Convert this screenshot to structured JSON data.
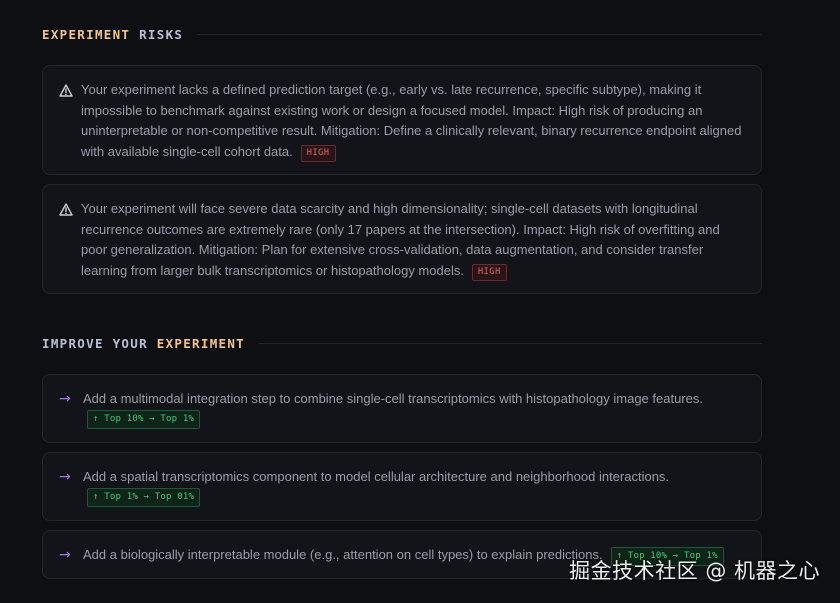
{
  "risks_section": {
    "title_accent": "EXPERIMENT",
    "title_plain": "RISKS",
    "items": [
      {
        "text": "Your experiment lacks a defined prediction target (e.g., early vs. late recurrence, specific subtype), making it impossible to benchmark against existing work or design a focused model. Impact: High risk of producing an uninterpretable or non-competitive result. Mitigation: Define a clinically relevant, binary recurrence endpoint aligned with available single-cell cohort data.",
        "severity": "HIGH",
        "icon": "warning-icon"
      },
      {
        "text": "Your experiment will face severe data scarcity and high dimensionality; single-cell datasets with longitudinal recurrence outcomes are extremely rare (only 17 papers at the intersection). Impact: High risk of overfitting and poor generalization. Mitigation: Plan for extensive cross-validation, data augmentation, and consider transfer learning from larger bulk transcriptomics or histopathology models.",
        "severity": "HIGH",
        "icon": "warning-icon"
      }
    ]
  },
  "improve_section": {
    "title_plain_1": "IMPROVE",
    "title_plain_2": "YOUR",
    "title_accent": "EXPERIMENT",
    "items": [
      {
        "text": "Add a multimodal integration step to combine single-cell transcriptomics with histopathology image features.",
        "badge": "↑ Top 10% → Top 1%",
        "icon": "arrow-right-icon"
      },
      {
        "text": "Add a spatial transcriptomics component to model cellular architecture and neighborhood interactions.",
        "badge": "↑ Top 1% → Top 01%",
        "icon": "arrow-right-icon"
      },
      {
        "text": "Add a biologically interpretable module (e.g., attention on cell types) to explain predictions.",
        "badge": "↑ Top 10% → Top 1%",
        "icon": "arrow-right-icon"
      }
    ]
  },
  "watermark": "掘金技术社区 @ 机器之心",
  "colors": {
    "background": "#0e0f13",
    "card": "#131419",
    "accent_title": "#f0c48a",
    "high_badge": "#e06a6e",
    "top_badge": "#3fc977",
    "arrow": "#a774e8"
  }
}
